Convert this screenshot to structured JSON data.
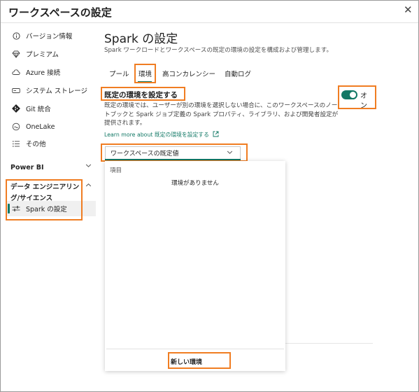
{
  "window": {
    "title": "ワークスペースの設定",
    "close_glyph": "✕"
  },
  "sidebar": {
    "items": [
      {
        "label": "バージョン情報",
        "icon": "info-icon"
      },
      {
        "label": "プレミアム",
        "icon": "diamond-icon"
      },
      {
        "label": "Azure 接続",
        "icon": "cloud-icon"
      },
      {
        "label": "システム ストレージ",
        "icon": "storage-icon"
      },
      {
        "label": "Git 統合",
        "icon": "git-icon"
      },
      {
        "label": "OneLake",
        "icon": "onelake-icon"
      },
      {
        "label": "その他",
        "icon": "list-icon"
      }
    ],
    "section_powerbi": "Power BI",
    "section_de_line1": "データ エンジニアリン",
    "section_de_line2": "グ/サイエンス",
    "spark_item": {
      "label": "Spark の設定",
      "icon": "sliders-icon"
    }
  },
  "main": {
    "title": "Spark の設定",
    "subtitle": "Spark ワークロードとワークスペースの既定の環境の設定を構成および管理します。",
    "tabs": [
      "プール",
      "環境",
      "高コンカレンシー",
      "自動ログ"
    ],
    "selected_tab": "環境",
    "section_title": "既定の環境を設定する",
    "description": "既定の環境では、ユーザーが別の環境を選択しない場合に、このワークスペースのノートブックと Spark ジョブ定義の Spark プロパティ、ライブラリ、および開発者設定が提供されます。",
    "link_prefix": "Learn more about",
    "link_text": "既定の環境を設定する",
    "toggle": {
      "state": "on",
      "label_line1": "オ",
      "label_line2": "ン"
    },
    "dropdown": {
      "value": "ワークスペースの既定値"
    },
    "panel": {
      "label": "項目",
      "empty": "環境がありません",
      "new_button": "新しい環境"
    }
  },
  "colors": {
    "accent": "#117865",
    "highlight": "#f07d22"
  }
}
